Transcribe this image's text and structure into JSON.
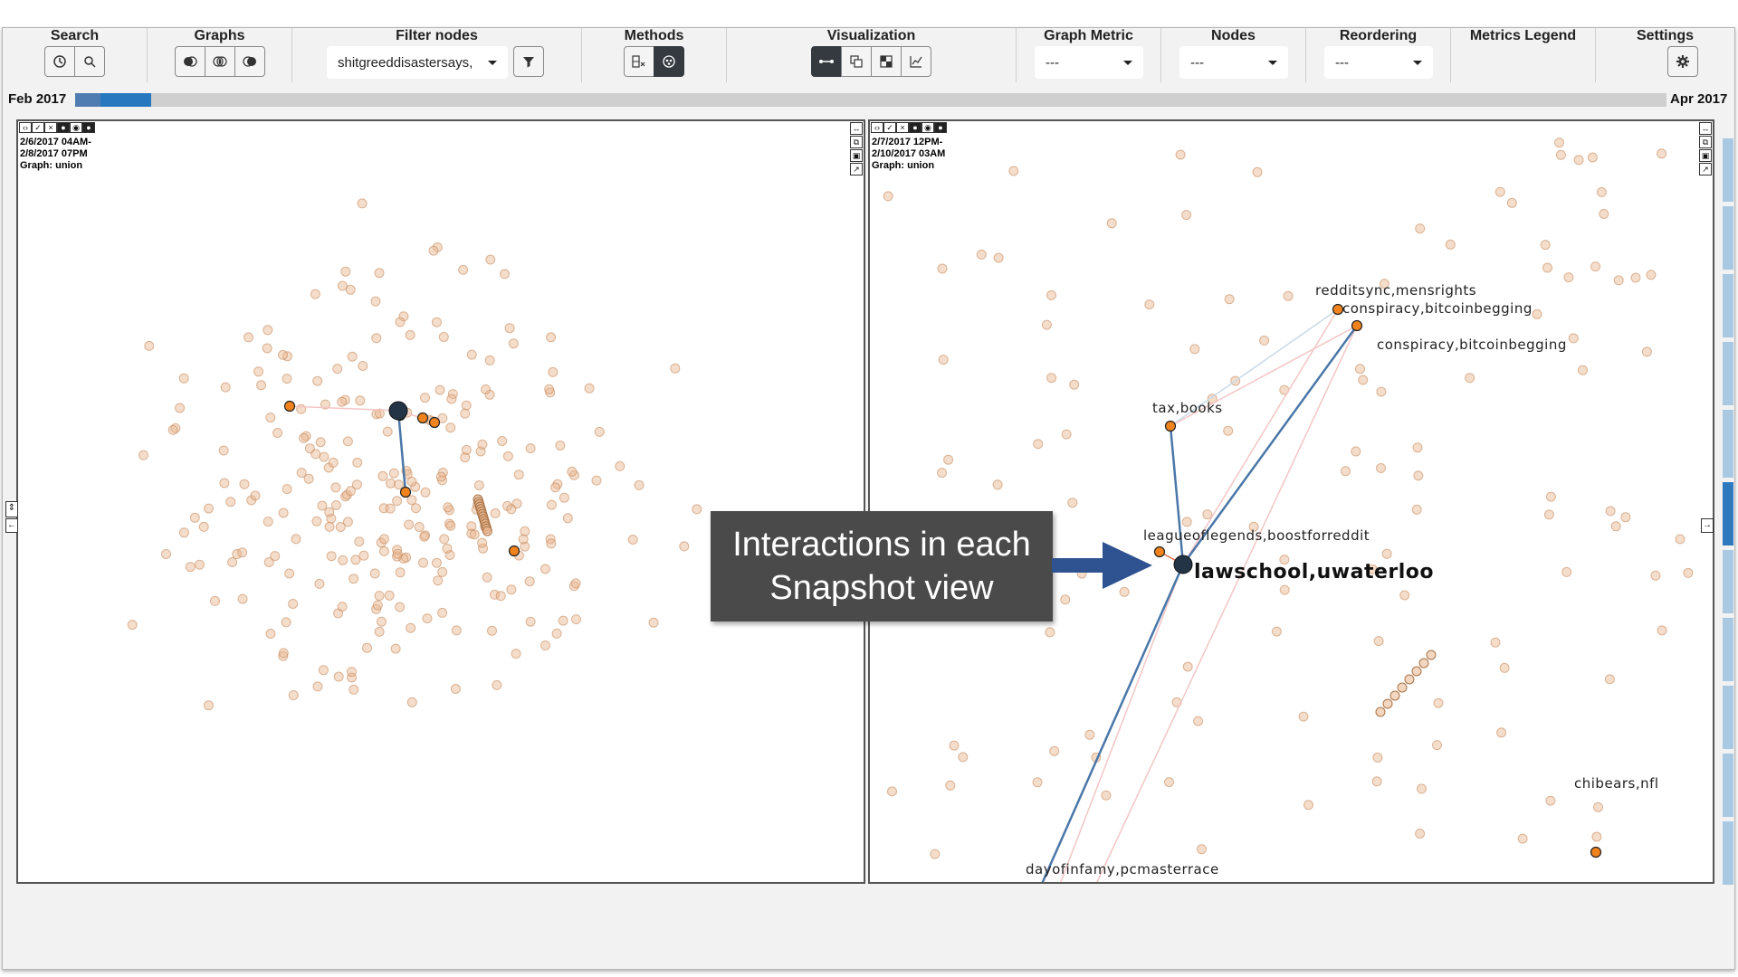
{
  "toolbar": {
    "search": {
      "title": "Search",
      "buttons": [
        "history-icon",
        "search-icon"
      ]
    },
    "graphs": {
      "title": "Graphs",
      "buttons": [
        "graph-a-icon",
        "graph-both-icon",
        "graph-b-icon"
      ]
    },
    "filter_nodes": {
      "title": "Filter nodes",
      "selected": "shitgreeddisastersays,",
      "button": "filter-icon"
    },
    "methods": {
      "title": "Methods",
      "buttons": [
        "exclude-method-icon",
        "community-method-icon"
      ],
      "active": "community-method-icon"
    },
    "visualization": {
      "title": "Visualization",
      "buttons": [
        "node-link-icon",
        "juxtapose-icon",
        "matrix-icon",
        "line-chart-icon"
      ],
      "active": "node-link-icon"
    },
    "graph_metric": {
      "title": "Graph Metric",
      "selected": "---"
    },
    "nodes": {
      "title": "Nodes",
      "selected": "---"
    },
    "reordering": {
      "title": "Reordering",
      "selected": "---"
    },
    "metrics_legend": {
      "title": "Metrics Legend"
    },
    "settings": {
      "title": "Settings",
      "button": "gear-icon"
    }
  },
  "timeline": {
    "start": "Feb 2017",
    "end": "Apr 2017",
    "selection_start_fraction": 0.0,
    "selection_end_fraction": 0.048
  },
  "panels": [
    {
      "id": "left",
      "info": [
        "2/6/2017 04AM-",
        "2/8/2017 07PM",
        "Graph: union"
      ],
      "labels": []
    },
    {
      "id": "right",
      "info": [
        "2/7/2017 12PM-",
        "2/10/2017 03AM",
        "Graph: union"
      ],
      "labels": {
        "l1": "redditsync,mensrights",
        "l2": "conspiracy,bitcoinbegging",
        "l3": "conspiracy,bitcoinbegging",
        "l4": "tax,books",
        "l5": "leagueoflegends,boostforreddit",
        "l6": "lawschool,uwaterloo",
        "l7": "dayofinfamy,pcmasterrace",
        "l8": "chibears,nfl"
      }
    }
  ],
  "callout": {
    "line1": "Interactions in each",
    "line2": "Snapshot view"
  },
  "colors": {
    "node_faded": "#e8b48c",
    "node_highlight": "#f0831e",
    "center_node": "#243447",
    "edge_strong": "#4a77a8",
    "edge_light_blue": "#c9d9e8",
    "edge_light_red": "#f4c5c5",
    "callout_bg": "#4a4a4a",
    "arrow": "#2f5290"
  }
}
